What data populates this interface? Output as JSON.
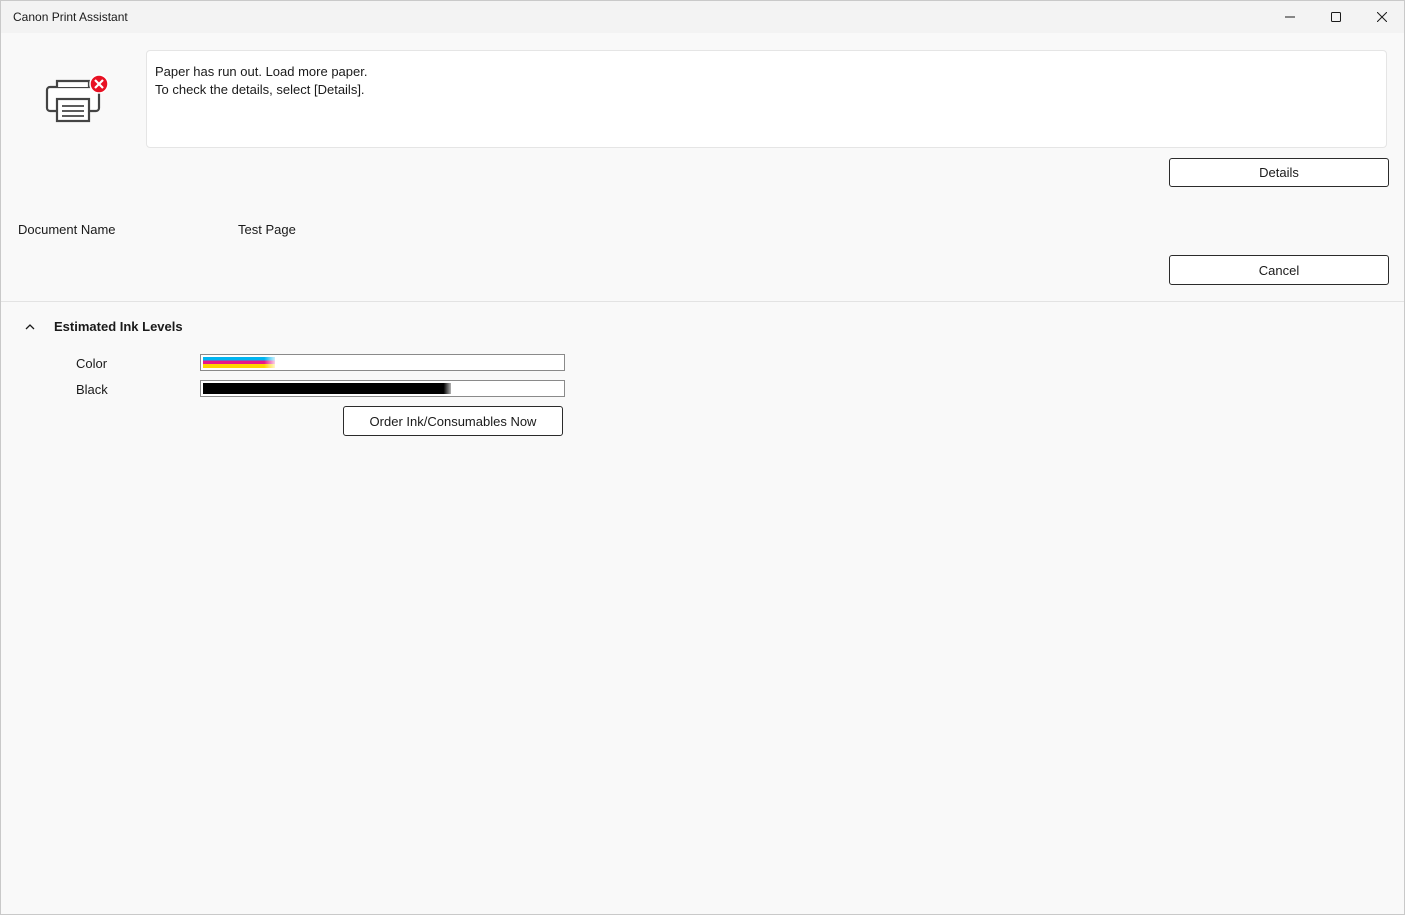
{
  "window": {
    "title": "Canon Print Assistant",
    "controls": [
      "minimize-icon",
      "maximize-icon",
      "close-icon"
    ]
  },
  "status": {
    "icon": "printer-error-icon",
    "message_line1": "Paper has run out. Load more paper.",
    "message_line2": "To check the details, select [Details]."
  },
  "buttons": {
    "details_label": "Details",
    "cancel_label": "Cancel",
    "order_label": "Order Ink/Consumables Now"
  },
  "document": {
    "label": "Document Name",
    "value": "Test Page"
  },
  "ink_section": {
    "title": "Estimated Ink Levels",
    "expanded": true,
    "color": {
      "label": "Color",
      "level": 0.2
    },
    "black": {
      "label": "Black",
      "level": 0.69
    }
  },
  "colors": {
    "cyan": "#00b4f0",
    "magenta": "#e8168b",
    "yellow": "#ffd400",
    "black": "#000000",
    "error_red": "#e81123"
  }
}
